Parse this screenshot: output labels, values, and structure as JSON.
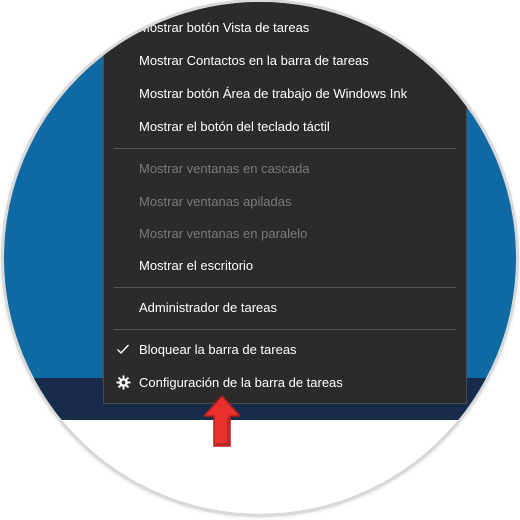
{
  "context_menu": {
    "items": [
      {
        "label": "Mostrar botón Vista de tareas"
      },
      {
        "label": "Mostrar Contactos en la barra de tareas"
      },
      {
        "label": "Mostrar botón Área de trabajo de Windows Ink"
      },
      {
        "label": "Mostrar el botón del teclado táctil"
      },
      {
        "label": "Mostrar ventanas en cascada"
      },
      {
        "label": "Mostrar ventanas apiladas"
      },
      {
        "label": "Mostrar ventanas en paralelo"
      },
      {
        "label": "Mostrar el escritorio"
      },
      {
        "label": "Administrador de tareas"
      },
      {
        "label": "Bloquear la barra de tareas"
      },
      {
        "label": "Configuración de la barra de tareas"
      }
    ]
  },
  "icons": {
    "check": "checkmark-icon",
    "settings": "gear-icon",
    "pointer": "red-arrow-icon"
  },
  "colors": {
    "menu_bg": "#2b2b2b",
    "menu_text": "#ffffff",
    "disabled_text": "#7a7a7a",
    "desktop_blue": "#0f6aa3",
    "taskbar": "#172b4a",
    "arrow_red": "#e8302f"
  }
}
